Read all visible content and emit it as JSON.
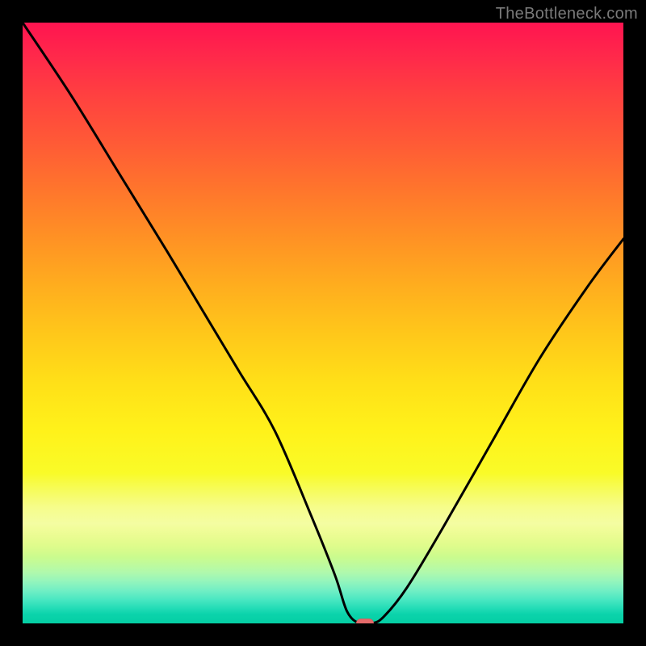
{
  "watermark": "TheBottleneck.com",
  "chart_data": {
    "type": "line",
    "title": "",
    "xlabel": "",
    "ylabel": "",
    "xlim": [
      0,
      100
    ],
    "ylim": [
      0,
      100
    ],
    "grid": false,
    "legend": false,
    "background_gradient": {
      "top": "#ff1450",
      "mid": "#ffe018",
      "bottom": "#05cfa4"
    },
    "series": [
      {
        "name": "bottleneck-curve",
        "x": [
          0,
          8,
          16,
          24,
          30,
          36,
          42,
          48,
          52,
          54,
          56,
          58,
          60,
          64,
          70,
          78,
          86,
          94,
          100
        ],
        "values": [
          100,
          88,
          75,
          62,
          52,
          42,
          32,
          18,
          8,
          2,
          0,
          0,
          1,
          6,
          16,
          30,
          44,
          56,
          64
        ]
      }
    ],
    "marker": {
      "name": "min-point",
      "x": 57,
      "y": 0,
      "color": "#e46a6a"
    }
  }
}
